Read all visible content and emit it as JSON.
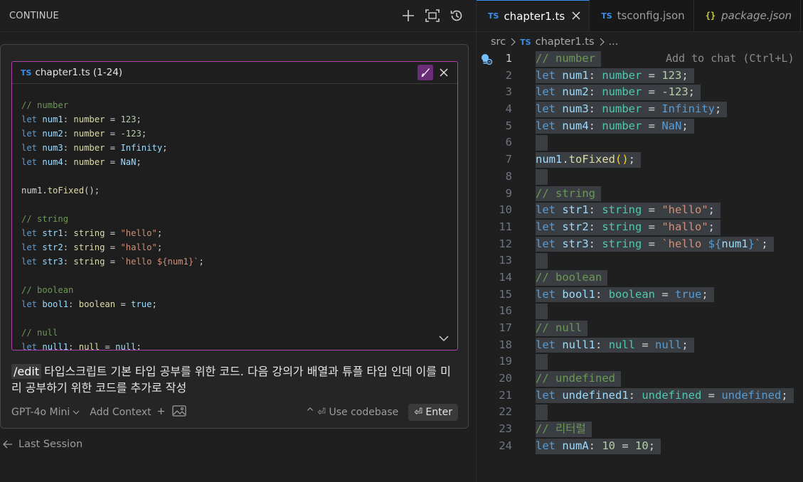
{
  "left_panel": {
    "title": "CONTINUE",
    "context": {
      "file_badge": "TS",
      "file_label": "chapter1.ts (1-24)",
      "code_lines": [
        "// number",
        "let num1: number = 123;",
        "let num2: number = -123;",
        "let num3: number = Infinity;",
        "let num4: number = NaN;",
        "",
        "num1.toFixed();",
        "",
        "// string",
        "let str1: string = \"hello\";",
        "let str2: string = \"hallo\";",
        "let str3: string = `hello ${num1}`;",
        "",
        "// boolean",
        "let bool1: boolean = true;",
        "",
        "// null",
        "let null1: null = null;"
      ]
    },
    "prompt": {
      "command": "/edit",
      "text": "타입스크립트 기본 타입 공부를 위한 코드. 다음 강의가 배열과 튜플 타입 인데 이를 미리 공부하기 위한 코드를 추가로 작성"
    },
    "footer": {
      "model": "GPT-4o Mini",
      "add_context": "Add Context",
      "use_codebase": "^ ⏎ Use codebase",
      "enter": "⏎ Enter"
    },
    "last_session": "Last Session"
  },
  "editor": {
    "tabs": [
      {
        "badge": "TS",
        "label": "chapter1.ts",
        "active": true,
        "closable": true
      },
      {
        "badge": "TS",
        "label": "tsconfig.json",
        "active": false
      },
      {
        "badge": "{}",
        "label": "package.json",
        "active": false,
        "italic": true
      }
    ],
    "breadcrumb": {
      "folder": "src",
      "file_badge": "TS",
      "file": "chapter1.ts",
      "more": "..."
    },
    "inline_hint": "Add to chat (Ctrl+L) |",
    "line_numbers": [
      "1",
      "2",
      "3",
      "4",
      "5",
      "6",
      "7",
      "8",
      "9",
      "10",
      "11",
      "12",
      "13",
      "14",
      "15",
      "16",
      "17",
      "18",
      "19",
      "20",
      "21",
      "22",
      "23",
      "24"
    ],
    "code_lines": [
      "// number",
      "let num1: number = 123;",
      "let num2: number = -123;",
      "let num3: number = Infinity;",
      "let num4: number = NaN;",
      "",
      "num1.toFixed();",
      "",
      "// string",
      "let str1: string = \"hello\";",
      "let str2: string = \"hallo\";",
      "let str3: string = `hello ${num1}`;",
      "",
      "// boolean",
      "let bool1: boolean = true;",
      "",
      "// null",
      "let null1: null = null;",
      "",
      "// undefined",
      "let undefined1: undefined = undefined;",
      "",
      "// 리터럴",
      "let numA: 10 = 10;"
    ]
  },
  "colors": {
    "selection": "#3a3d41",
    "context_border": "#b03fb0",
    "keyword": "#569cd6",
    "string": "#ce9178",
    "comment": "#6a9955",
    "number": "#b5cea8"
  }
}
